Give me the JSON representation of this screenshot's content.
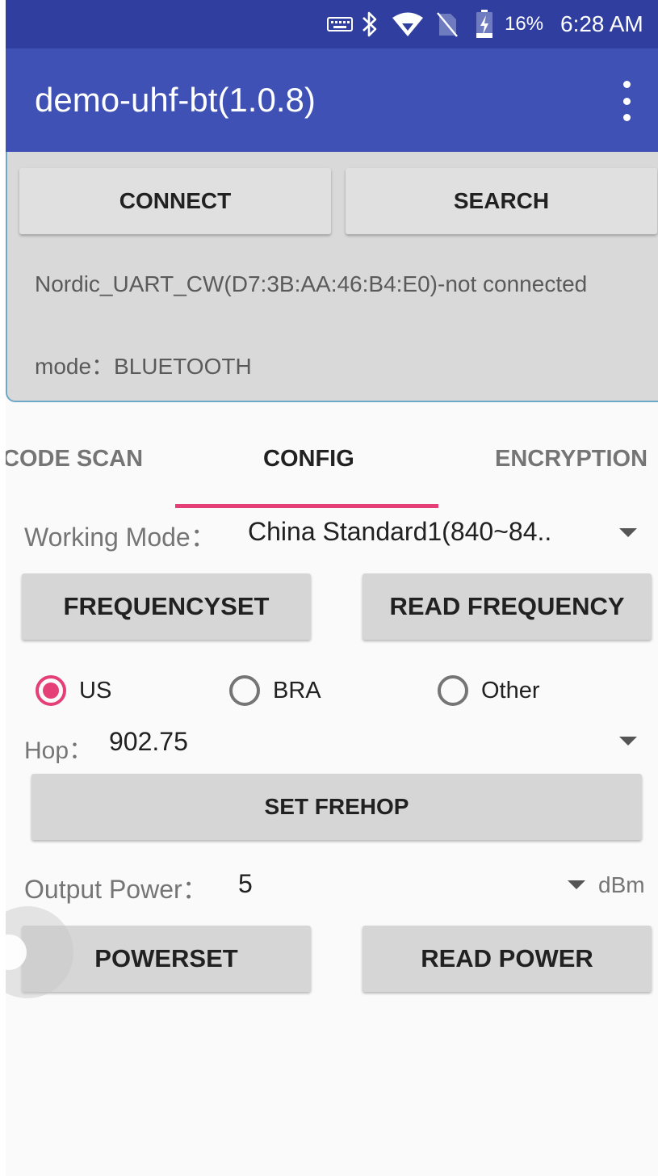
{
  "status_bar": {
    "icons": [
      "keyboard-icon",
      "bluetooth-icon",
      "wifi-icon",
      "no-sim-icon",
      "battery-charging-icon"
    ],
    "battery": "16%",
    "time": "6:28 AM"
  },
  "app_bar": {
    "title": "demo-uhf-bt(1.0.8)",
    "menu_icon": "more-vert-icon"
  },
  "connection": {
    "connect_label": "CONNECT",
    "search_label": "SEARCH",
    "device_status": "Nordic_UART_CW(D7:3B:AA:46:B4:E0)-not connected",
    "mode": "mode：BLUETOOTH"
  },
  "tabs": [
    {
      "label": "CODE SCAN",
      "active": false
    },
    {
      "label": "CONFIG",
      "active": true
    },
    {
      "label": "ENCRYPTION",
      "active": false
    }
  ],
  "config": {
    "working_mode_label": "Working Mode：",
    "working_mode_value": "China Standard1(840~84..",
    "frequencyset_label": "FREQUENCYSET",
    "read_frequency_label": "READ FREQUENCY",
    "regions": [
      {
        "label": "US",
        "selected": true
      },
      {
        "label": "BRA",
        "selected": false
      },
      {
        "label": "Other",
        "selected": false
      }
    ],
    "hop_label": "Hop：",
    "hop_value": "902.75",
    "set_frehop_label": "SET FREHOP",
    "output_power_label": "Output Power：",
    "output_power_value": "5",
    "power_unit": "dBm",
    "powerset_label": "POWERSET",
    "read_power_label": "READ POWER"
  },
  "colors": {
    "status_bar": "#303f9f",
    "app_bar": "#3f51b5",
    "accent": "#e53f78",
    "panel": "#d9d9d9"
  }
}
